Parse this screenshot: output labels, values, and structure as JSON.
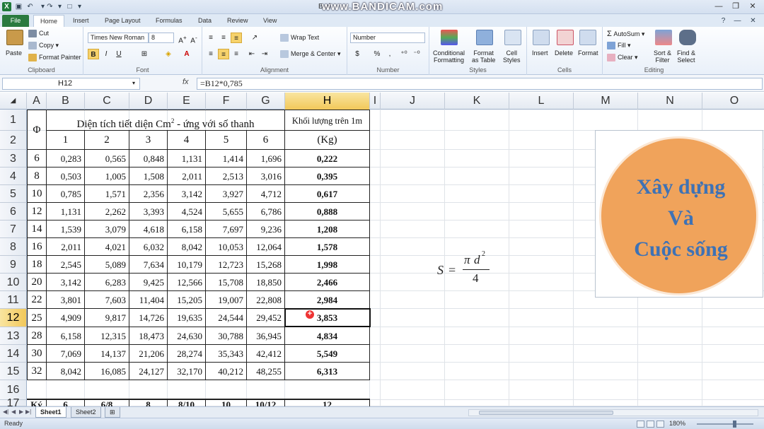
{
  "window": {
    "title": "Book1 - Microsoft Excel",
    "title_visible": "B                                                        el",
    "watermark": "www.BANDICAM.com"
  },
  "ribbon_tabs": [
    "File",
    "Home",
    "Insert",
    "Page Layout",
    "Formulas",
    "Data",
    "Review",
    "View"
  ],
  "clipboard": {
    "paste": "Paste",
    "cut": "Cut",
    "copy": "Copy",
    "format_painter": "Format Painter",
    "label": "Clipboard"
  },
  "font": {
    "name": "Times New Roman",
    "size": "8",
    "label": "Font",
    "bold": "B",
    "italic": "I",
    "underline": "U"
  },
  "alignment": {
    "wrap": "Wrap Text",
    "merge": "Merge & Center",
    "label": "Alignment"
  },
  "number": {
    "format": "Number",
    "pct": "%",
    "comma": ",",
    "label": "Number"
  },
  "styles": {
    "cond1": "Conditional",
    "cond2": "Formatting",
    "table1": "Format",
    "table2": "as Table",
    "cell1": "Cell",
    "cell2": "Styles",
    "label": "Styles"
  },
  "cells": {
    "insert": "Insert",
    "delete": "Delete",
    "format": "Format",
    "label": "Cells"
  },
  "editing": {
    "autosum": "AutoSum",
    "fill": "Fill",
    "clear": "Clear",
    "sort1": "Sort &",
    "sort2": "Filter",
    "find1": "Find &",
    "find2": "Select",
    "label": "Editing"
  },
  "namebox": "H12",
  "fx": "fx",
  "formula": "=B12*0,785",
  "columns": [
    "A",
    "B",
    "C",
    "D",
    "E",
    "F",
    "G",
    "H",
    "I",
    "J",
    "K",
    "L",
    "M",
    "N",
    "O"
  ],
  "rows": [
    "1",
    "2",
    "3",
    "4",
    "5",
    "6",
    "7",
    "8",
    "9",
    "10",
    "11",
    "12",
    "13",
    "14",
    "15",
    "16",
    "17"
  ],
  "table": {
    "phi": "Φ",
    "header_main": "Diện tích tiết diện Cm",
    "header_sup": "2",
    "header_tail": " - ứng với số thanh",
    "counts": [
      "1",
      "2",
      "3",
      "4",
      "5",
      "6"
    ],
    "weight_title": "Khối lượng trên 1m",
    "weight_unit": "(Kg)",
    "data": [
      [
        "6",
        "0,283",
        "0,565",
        "0,848",
        "1,131",
        "1,414",
        "1,696",
        "0,222"
      ],
      [
        "8",
        "0,503",
        "1,005",
        "1,508",
        "2,011",
        "2,513",
        "3,016",
        "0,395"
      ],
      [
        "10",
        "0,785",
        "1,571",
        "2,356",
        "3,142",
        "3,927",
        "4,712",
        "0,617"
      ],
      [
        "12",
        "1,131",
        "2,262",
        "3,393",
        "4,524",
        "5,655",
        "6,786",
        "0,888"
      ],
      [
        "14",
        "1,539",
        "3,079",
        "4,618",
        "6,158",
        "7,697",
        "9,236",
        "1,208"
      ],
      [
        "16",
        "2,011",
        "4,021",
        "6,032",
        "8,042",
        "10,053",
        "12,064",
        "1,578"
      ],
      [
        "18",
        "2,545",
        "5,089",
        "7,634",
        "10,179",
        "12,723",
        "15,268",
        "1,998"
      ],
      [
        "20",
        "3,142",
        "6,283",
        "9,425",
        "12,566",
        "15,708",
        "18,850",
        "2,466"
      ],
      [
        "22",
        "3,801",
        "7,603",
        "11,404",
        "15,205",
        "19,007",
        "22,808",
        "2,984"
      ],
      [
        "25",
        "4,909",
        "9,817",
        "14,726",
        "19,635",
        "24,544",
        "29,452",
        "3,853"
      ],
      [
        "28",
        "6,158",
        "12,315",
        "18,473",
        "24,630",
        "30,788",
        "36,945",
        "4,834"
      ],
      [
        "30",
        "7,069",
        "14,137",
        "21,206",
        "28,274",
        "35,343",
        "42,412",
        "5,549"
      ],
      [
        "32",
        "8,042",
        "16,085",
        "24,127",
        "32,170",
        "40,212",
        "48,255",
        "6,313"
      ]
    ],
    "row17": [
      "Ký",
      "6",
      "6/8",
      "8",
      "8/10",
      "10",
      "10/12",
      "12"
    ]
  },
  "equation": {
    "lhs": "S",
    "eq": "=",
    "pi": "π",
    "d": "d",
    "exp": "2",
    "den": "4"
  },
  "picture": {
    "line1": "Xây dựng",
    "line2": "Và",
    "line3": "Cuộc sống"
  },
  "sheets": [
    "Sheet1",
    "Sheet2"
  ],
  "status": {
    "ready": "Ready",
    "zoom": "180%"
  },
  "colors": {
    "accent": "#2a7a3f",
    "select": "#f2c85a",
    "circle": "#f0a35b",
    "circle_text": "#3e72b5"
  }
}
